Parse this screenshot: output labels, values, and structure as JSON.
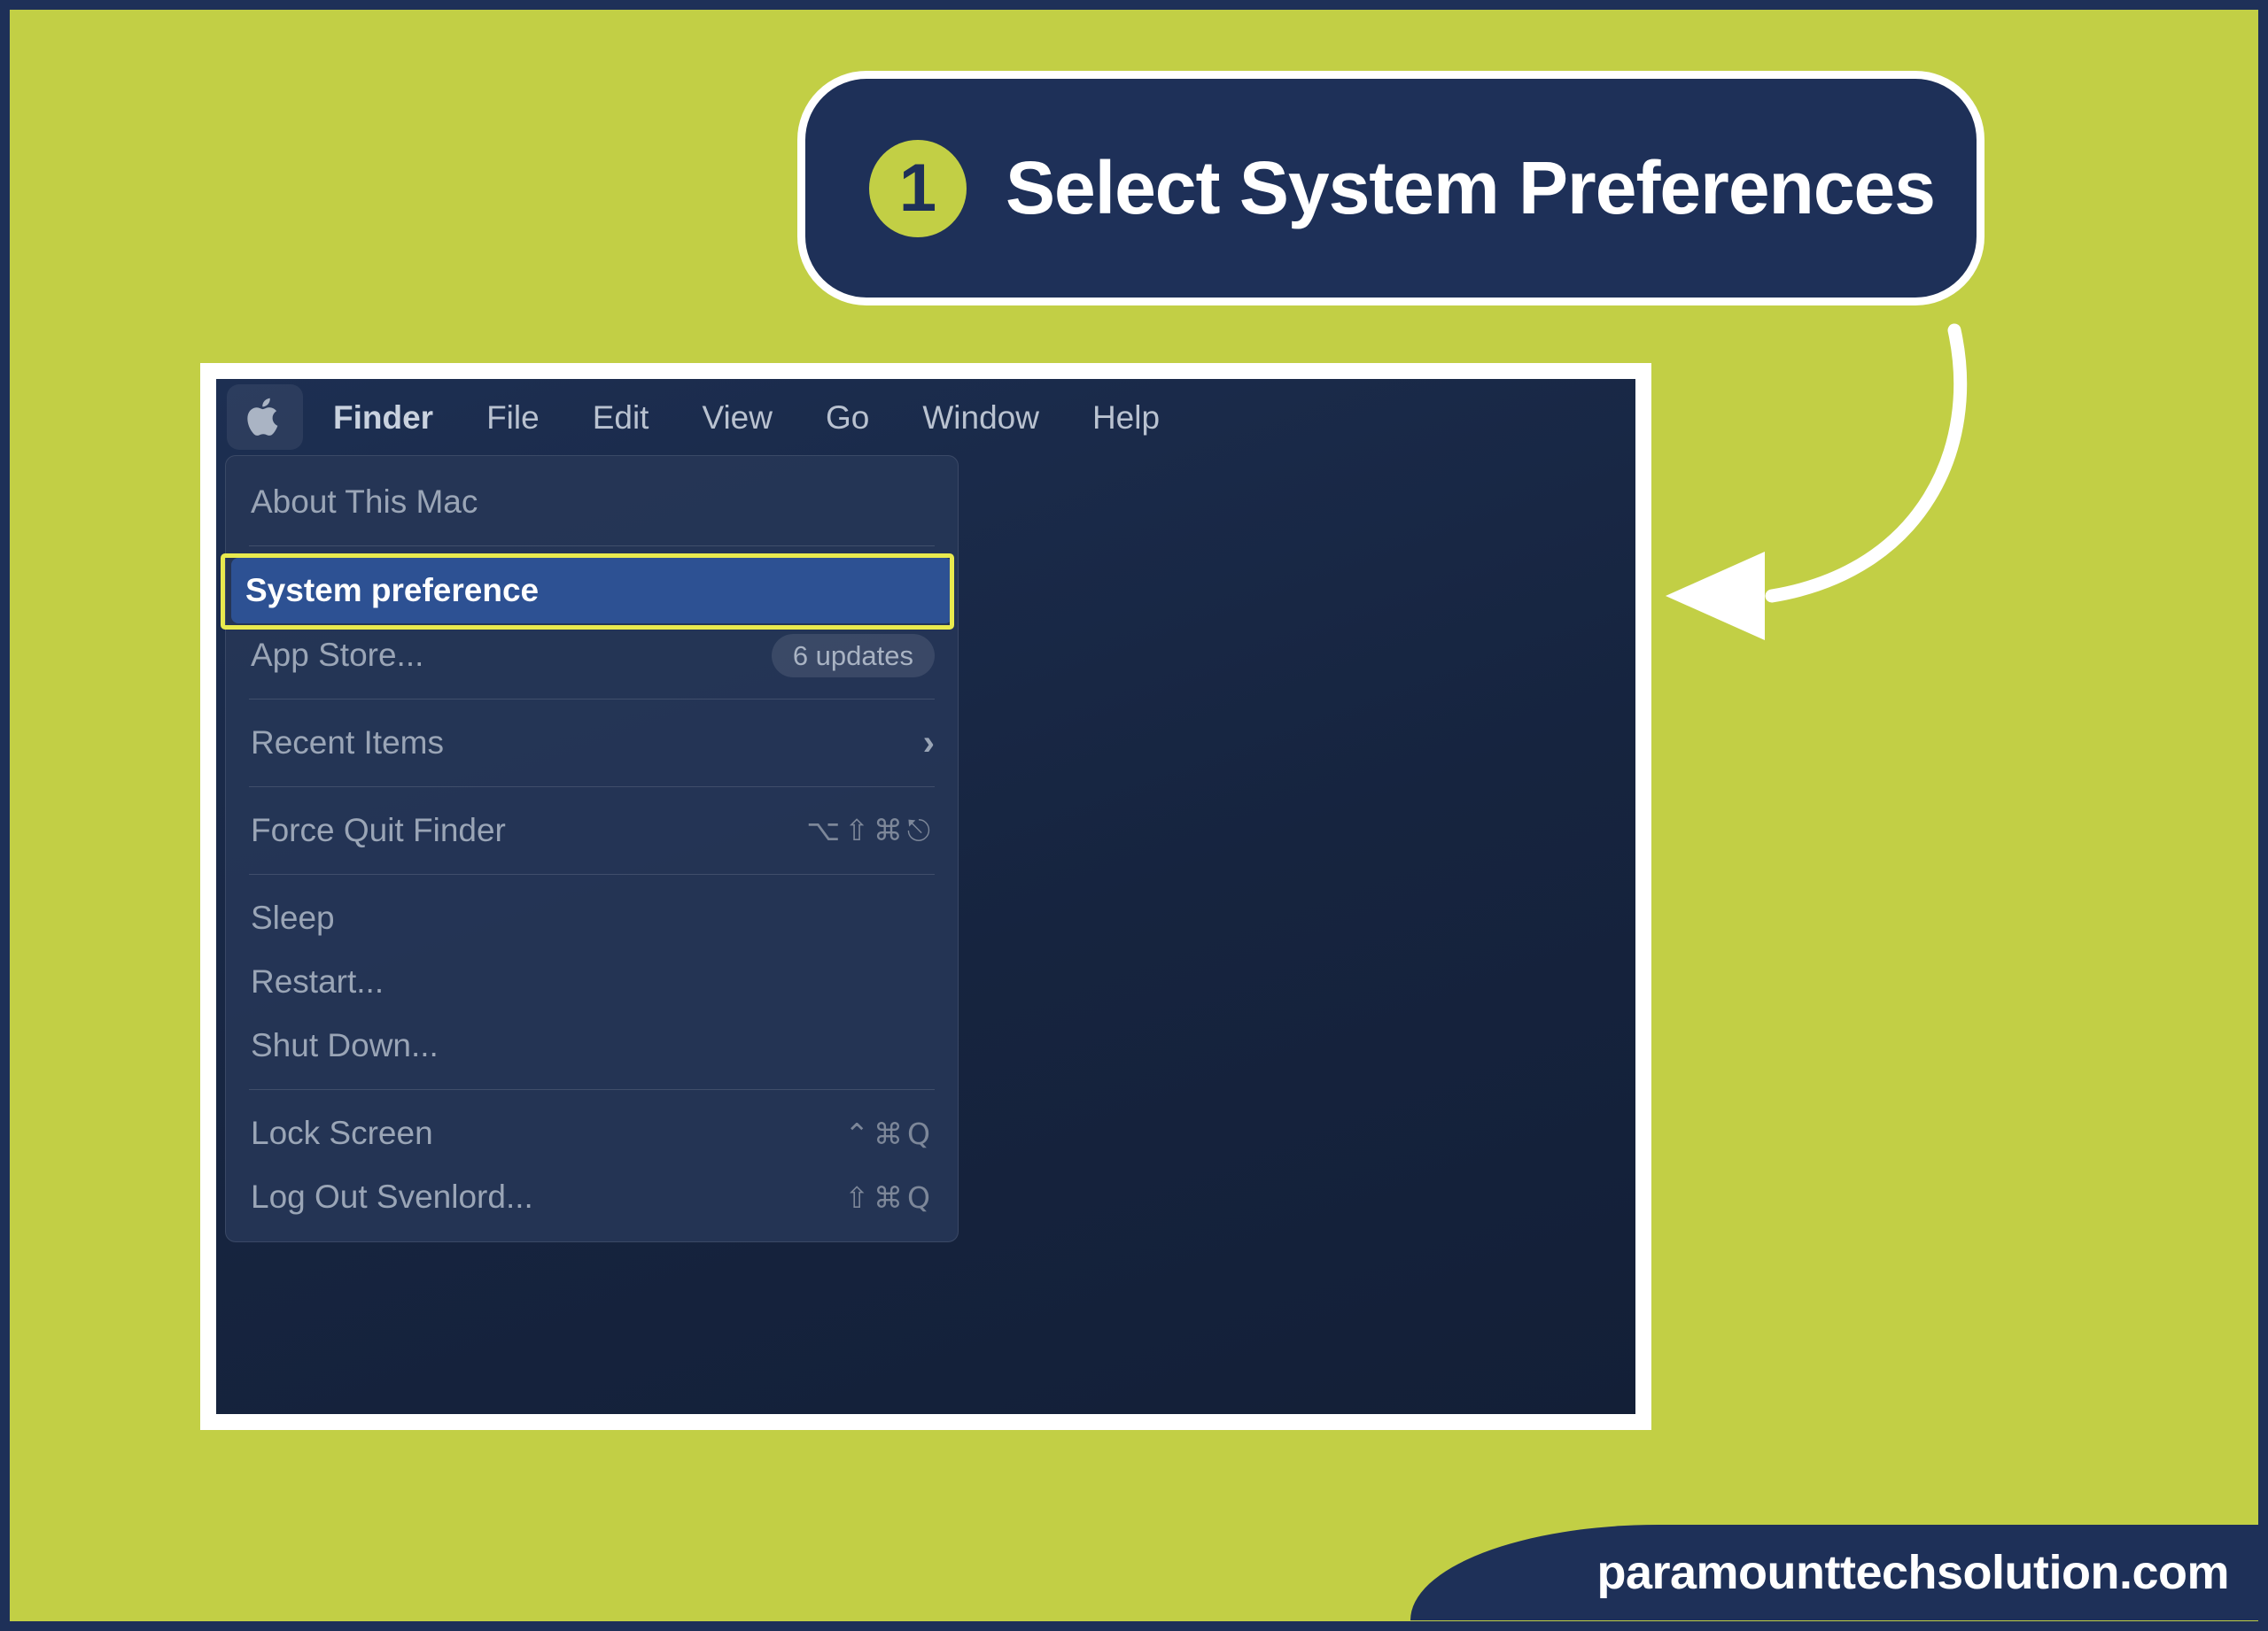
{
  "colors": {
    "background_green": "#C2CF45",
    "navy": "#1E3058",
    "white": "#FFFFFF",
    "highlight_yellow": "#E9EA4E",
    "selection_blue": "#2D5193"
  },
  "banner": {
    "step_number": "1",
    "title": "Select System Preferences"
  },
  "screenshot": {
    "menubar": {
      "apple_icon": "apple-logo-icon",
      "items": [
        {
          "label": "Finder",
          "bold": true
        },
        {
          "label": "File",
          "bold": false
        },
        {
          "label": "Edit",
          "bold": false
        },
        {
          "label": "View",
          "bold": false
        },
        {
          "label": "Go",
          "bold": false
        },
        {
          "label": "Window",
          "bold": false
        },
        {
          "label": "Help",
          "bold": false
        }
      ]
    },
    "apple_menu": {
      "items": [
        {
          "label": "About This Mac",
          "shortcut": "",
          "badge": "",
          "selected": false,
          "submenu": false
        },
        {
          "label": "System preference",
          "shortcut": "",
          "badge": "",
          "selected": true,
          "submenu": false
        },
        {
          "label": "App Store...",
          "shortcut": "",
          "badge": "6 updates",
          "selected": false,
          "submenu": false
        },
        {
          "label": "Recent Items",
          "shortcut": "",
          "badge": "",
          "selected": false,
          "submenu": true
        },
        {
          "label": "Force Quit Finder",
          "shortcut": "⌥⇧⌘⎋",
          "badge": "",
          "selected": false,
          "submenu": false
        },
        {
          "label": "Sleep",
          "shortcut": "",
          "badge": "",
          "selected": false,
          "submenu": false
        },
        {
          "label": "Restart...",
          "shortcut": "",
          "badge": "",
          "selected": false,
          "submenu": false
        },
        {
          "label": "Shut Down...",
          "shortcut": "",
          "badge": "",
          "selected": false,
          "submenu": false
        },
        {
          "label": "Lock Screen",
          "shortcut": "⌃⌘Q",
          "badge": "",
          "selected": false,
          "submenu": false
        },
        {
          "label": "Log Out Svenlord...",
          "shortcut": "⇧⌘Q",
          "badge": "",
          "selected": false,
          "submenu": false
        }
      ]
    }
  },
  "annotation": {
    "arrow_icon": "curved-arrow-left-icon"
  },
  "footer": {
    "website": "paramounttechsolution.com"
  }
}
